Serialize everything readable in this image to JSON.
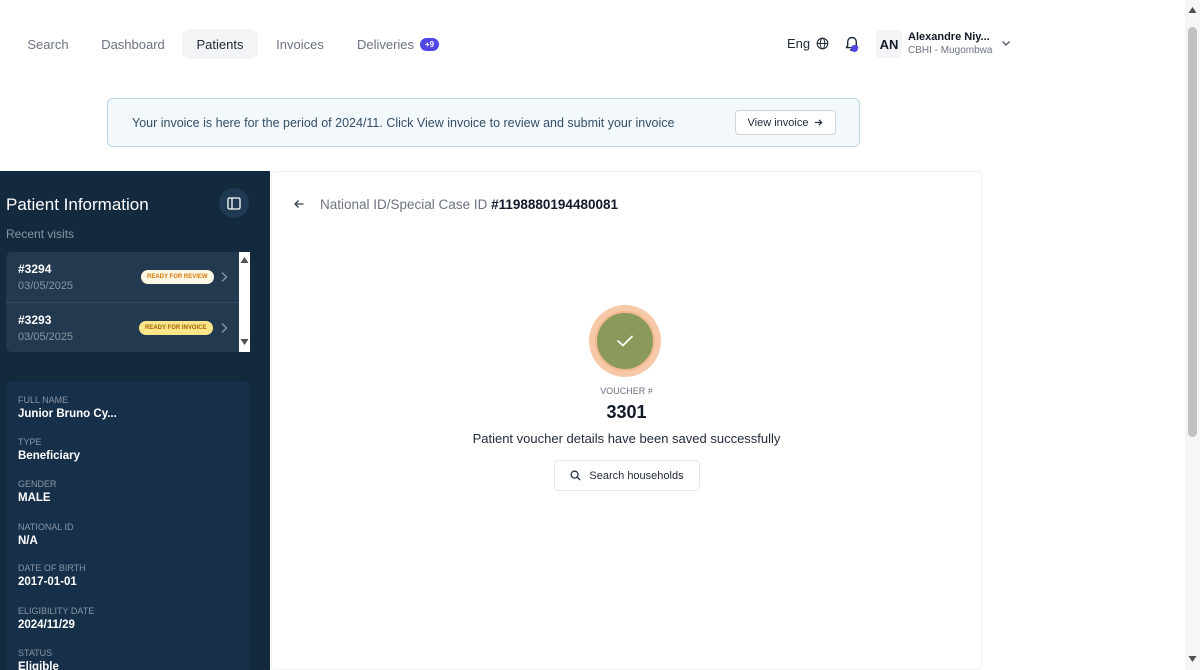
{
  "nav": {
    "tabs": [
      {
        "label": "Search"
      },
      {
        "label": "Dashboard"
      },
      {
        "label": "Patients"
      },
      {
        "label": "Invoices"
      },
      {
        "label": "Deliveries",
        "badge": "+9"
      }
    ],
    "active_tab": "Patients",
    "language": "Eng",
    "user": {
      "initials": "AN",
      "name": "Alexandre Niy...",
      "org": "CBHI - Mugombwa"
    }
  },
  "banner": {
    "text": "Your invoice is here for the period of 2024/11. Click View invoice to review and submit your invoice",
    "button_label": "View invoice"
  },
  "sidebar": {
    "title": "Patient Information",
    "subtitle": "Recent visits",
    "visits": [
      {
        "id": "#3294",
        "date": "03/05/2025",
        "status": "READY FOR REVIEW",
        "status_color": "#d97706"
      },
      {
        "id": "#3293",
        "date": "03/05/2025",
        "status": "READY FOR INVOICE",
        "status_color": "#a16207"
      }
    ],
    "fields": [
      {
        "label": "FULL NAME",
        "value": "Junior Bruno Cy..."
      },
      {
        "label": "TYPE",
        "value": "Beneficiary"
      },
      {
        "label": "GENDER",
        "value": "MALE"
      },
      {
        "label": "NATIONAL ID",
        "value": "N/A"
      },
      {
        "label": "DATE OF BIRTH",
        "value": "2017-01-01"
      },
      {
        "label": "ELIGIBILITY DATE",
        "value": "2024/11/29"
      },
      {
        "label": "STATUS",
        "value": "Eligible"
      }
    ]
  },
  "main": {
    "id_label": "National ID/Special Case ID",
    "id_value": "#1198880194480081",
    "voucher_label": "VOUCHER #",
    "voucher_number": "3301",
    "success_message": "Patient voucher details have been saved successfully",
    "search_button_label": "Search households"
  },
  "colors": {
    "accent": "#4f46e5",
    "sidebar_bg": "#13293d",
    "success_fill": "#8a9a5b",
    "success_ring": "#f7c9a8"
  }
}
